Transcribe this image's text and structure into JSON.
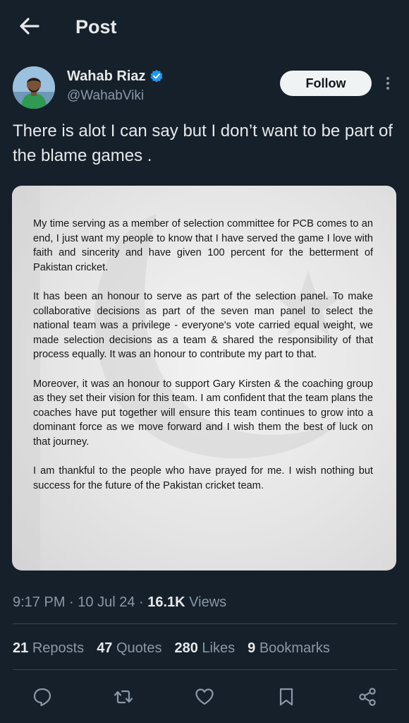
{
  "header": {
    "title": "Post"
  },
  "author": {
    "name": "Wahab Riaz",
    "handle": "@WahabViki",
    "follow_label": "Follow"
  },
  "tweet": {
    "text": "There is alot I can say but I don’t want to be part of the blame games ."
  },
  "statement": {
    "paragraphs": [
      "My time serving as a member of selection committee for PCB comes to an end, I just want my people to know that I have served the game I love with faith and sincerity and have given 100 percent for the betterment of Pakistan cricket.",
      "It has been an honour to serve as part of the selection panel. To make collaborative decisions as part of the seven man panel to select the national team was a privilege - everyone's vote carried equal weight, we made selection decisions as a team & shared the responsibility of that process equally. It was an honour to contribute my part to that.",
      "Moreover, it was an honour to support Gary Kirsten & the coaching group as they set their vision for this team. I am confident that the team plans the coaches have put together will ensure this team continues to grow into a dominant force as we move forward and I wish them the best of luck on that journey.",
      "I am thankful to the people who have prayed for me. I wish nothing but success for the future of the Pakistan cricket team."
    ]
  },
  "meta": {
    "time": "9:17 PM",
    "date": "10 Jul 24",
    "separator": " · ",
    "views_count": "16.1K",
    "views_label": "Views"
  },
  "stats": {
    "reposts": {
      "count": "21",
      "label": "Reposts"
    },
    "quotes": {
      "count": "47",
      "label": "Quotes"
    },
    "likes": {
      "count": "280",
      "label": "Likes"
    },
    "bookmarks": {
      "count": "9",
      "label": "Bookmarks"
    }
  },
  "icons": {
    "back": "arrow-left-icon",
    "verified": "verified-badge-icon",
    "more": "more-vertical-icon",
    "reply": "reply-icon",
    "repost": "repost-icon",
    "like": "heart-icon",
    "bookmark": "bookmark-icon",
    "share": "share-icon"
  },
  "colors": {
    "background": "#15202b",
    "text_primary": "#e7e9ea",
    "text_secondary": "#8b98a5",
    "verified": "#1d9bf0",
    "follow_bg": "#eff3f4",
    "divider": "#38444d"
  }
}
